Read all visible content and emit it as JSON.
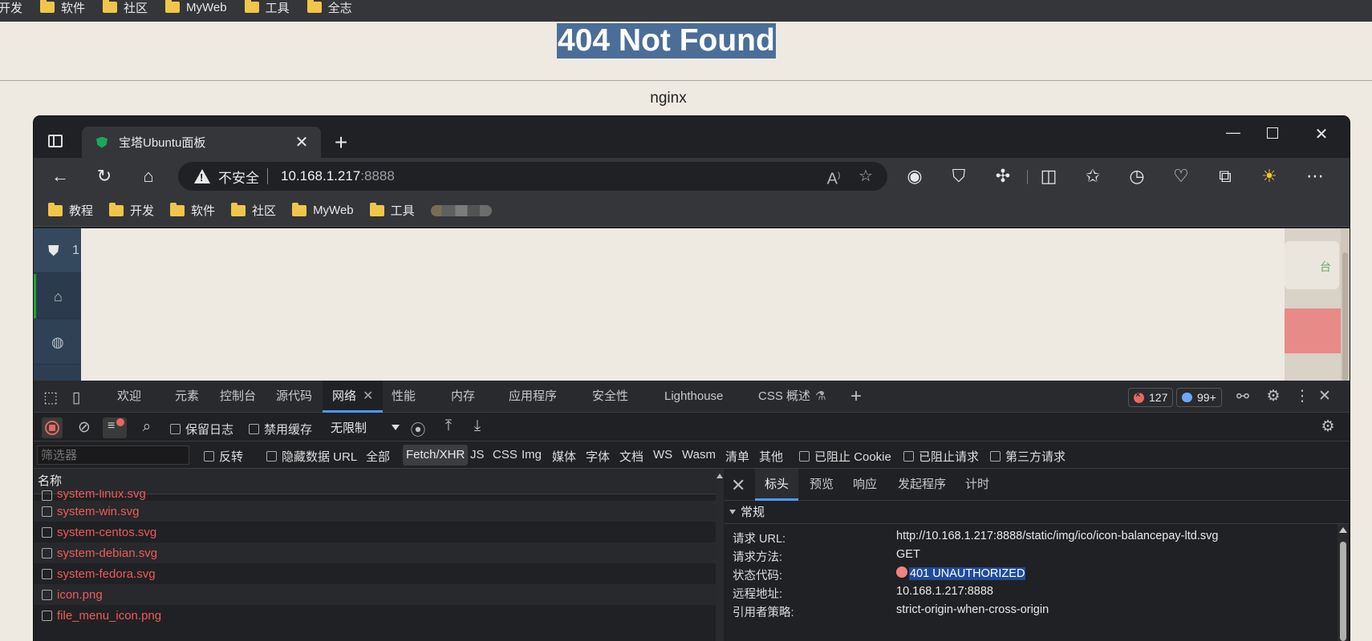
{
  "outer_bookmarks": [
    "开发",
    "软件",
    "社区",
    "MyWeb",
    "工具",
    "全志"
  ],
  "page": {
    "title": "404 Not Found",
    "footer": "nginx"
  },
  "browser": {
    "tab_title": "宝塔Ubuntu面板",
    "address": {
      "security_label": "不安全",
      "host": "10.168.1.217",
      "port": ":8888"
    },
    "bookmarks": [
      "教程",
      "开发",
      "软件",
      "社区",
      "MyWeb",
      "工具"
    ]
  },
  "panel": {
    "logo_text": "1",
    "right_text": "台"
  },
  "devtools": {
    "tabs": [
      "欢迎",
      "元素",
      "控制台",
      "源代码",
      "网络",
      "性能",
      "内存",
      "应用程序",
      "安全性",
      "Lighthouse",
      "CSS 概述"
    ],
    "active_tab": "网络",
    "error_count": "127",
    "message_count": "99+",
    "toolbar": {
      "preserve_log": "保留日志",
      "disable_cache": "禁用缓存",
      "throttling": "无限制"
    },
    "filter": {
      "placeholder": "筛选器",
      "invert": "反转",
      "hide_data_urls": "隐藏数据 URL",
      "types": [
        "全部",
        "Fetch/XHR",
        "JS",
        "CSS",
        "Img",
        "媒体",
        "字体",
        "文档",
        "WS",
        "Wasm",
        "清单",
        "其他"
      ],
      "active_type": "Fetch/XHR",
      "blocked_cookies": "已阻止 Cookie",
      "blocked_requests": "已阻止请求",
      "third_party": "第三方请求"
    },
    "list": {
      "header": "名称",
      "rows": [
        "system-linux.svg",
        "system-win.svg",
        "system-centos.svg",
        "system-debian.svg",
        "system-fedora.svg",
        "icon.png",
        "file_menu_icon.png"
      ]
    },
    "detail": {
      "tabs": [
        "标头",
        "预览",
        "响应",
        "发起程序",
        "计时"
      ],
      "active_tab": "标头",
      "section": "常规",
      "fields": [
        {
          "key": "请求 URL:",
          "value": "http://10.168.1.217:8888/static/img/ico/icon-balancepay-ltd.svg"
        },
        {
          "key": "请求方法:",
          "value": "GET"
        },
        {
          "key": "状态代码:",
          "value": "401 UNAUTHORIZED"
        },
        {
          "key": "远程地址:",
          "value": "10.168.1.217:8888"
        },
        {
          "key": "引用者策略:",
          "value": "strict-origin-when-cross-origin"
        }
      ]
    }
  }
}
